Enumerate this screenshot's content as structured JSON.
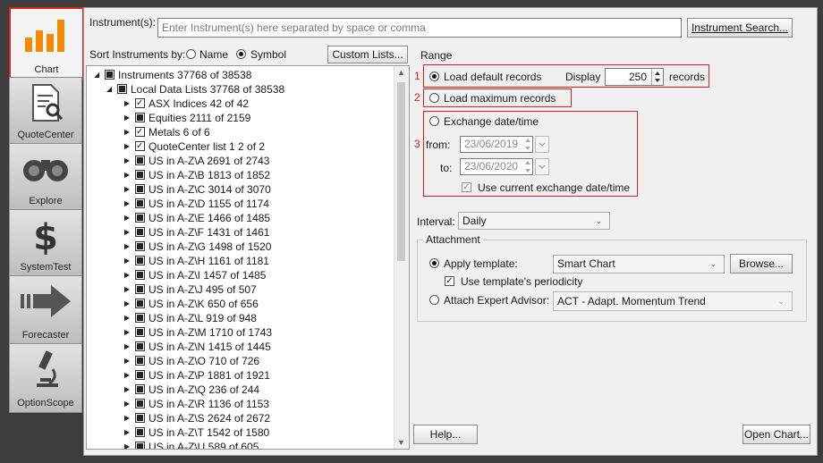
{
  "nav": {
    "items": [
      {
        "label": "Chart",
        "icon": "bar-chart-icon"
      },
      {
        "label": "QuoteCenter",
        "icon": "document-magnifier-icon"
      },
      {
        "label": "Explore",
        "icon": "binoculars-icon"
      },
      {
        "label": "SystemTest",
        "icon": "dollar-icon"
      },
      {
        "label": "Forecaster",
        "icon": "arrow-right-icon"
      },
      {
        "label": "OptionScope",
        "icon": "microscope-icon"
      }
    ]
  },
  "instruments": {
    "label": "Instrument(s):",
    "placeholder": "Enter Instrument(s) here separated by space or comma",
    "search_button": "Instrument Search..."
  },
  "sort": {
    "label": "Sort Instruments by:",
    "name_option": "Name",
    "symbol_option": "Symbol",
    "selected": "Symbol",
    "custom_lists_button": "Custom Lists..."
  },
  "tree": {
    "rows": [
      {
        "text": "Instruments  37768 of 38538",
        "level": 0,
        "expand": "open",
        "check": "partial"
      },
      {
        "text": "Local Data Lists  37768 of 38538",
        "level": 1,
        "expand": "open",
        "check": "partial"
      },
      {
        "text": "ASX Indices  42 of 42",
        "level": 2,
        "expand": "closed",
        "check": "checked"
      },
      {
        "text": "Equities  2111 of 2159",
        "level": 2,
        "expand": "closed",
        "check": "partial"
      },
      {
        "text": "Metals  6 of 6",
        "level": 2,
        "expand": "closed",
        "check": "checked"
      },
      {
        "text": "QuoteCenter list 1  2 of 2",
        "level": 2,
        "expand": "closed",
        "check": "checked"
      },
      {
        "text": "US in A-Z\\A  2691 of 2743",
        "level": 2,
        "expand": "closed",
        "check": "partial"
      },
      {
        "text": "US in A-Z\\B  1813 of 1852",
        "level": 2,
        "expand": "closed",
        "check": "partial"
      },
      {
        "text": "US in A-Z\\C  3014 of 3070",
        "level": 2,
        "expand": "closed",
        "check": "partial"
      },
      {
        "text": "US in A-Z\\D  1155 of 1174",
        "level": 2,
        "expand": "closed",
        "check": "partial"
      },
      {
        "text": "US in A-Z\\E  1466 of 1485",
        "level": 2,
        "expand": "closed",
        "check": "partial"
      },
      {
        "text": "US in A-Z\\F  1431 of 1461",
        "level": 2,
        "expand": "closed",
        "check": "partial"
      },
      {
        "text": "US in A-Z\\G  1498 of 1520",
        "level": 2,
        "expand": "closed",
        "check": "partial"
      },
      {
        "text": "US in A-Z\\H  1161 of 1181",
        "level": 2,
        "expand": "closed",
        "check": "partial"
      },
      {
        "text": "US in A-Z\\I  1457 of 1485",
        "level": 2,
        "expand": "closed",
        "check": "partial"
      },
      {
        "text": "US in A-Z\\J  495 of 507",
        "level": 2,
        "expand": "closed",
        "check": "partial"
      },
      {
        "text": "US in A-Z\\K  650 of 656",
        "level": 2,
        "expand": "closed",
        "check": "partial"
      },
      {
        "text": "US in A-Z\\L  919 of 948",
        "level": 2,
        "expand": "closed",
        "check": "partial"
      },
      {
        "text": "US in A-Z\\M  1710 of 1743",
        "level": 2,
        "expand": "closed",
        "check": "partial"
      },
      {
        "text": "US in A-Z\\N  1415 of 1445",
        "level": 2,
        "expand": "closed",
        "check": "partial"
      },
      {
        "text": "US in A-Z\\O  710 of 726",
        "level": 2,
        "expand": "closed",
        "check": "partial"
      },
      {
        "text": "US in A-Z\\P  1881 of 1921",
        "level": 2,
        "expand": "closed",
        "check": "partial"
      },
      {
        "text": "US in A-Z\\Q  236 of 244",
        "level": 2,
        "expand": "closed",
        "check": "partial"
      },
      {
        "text": "US in A-Z\\R  1136 of 1153",
        "level": 2,
        "expand": "closed",
        "check": "partial"
      },
      {
        "text": "US in A-Z\\S  2624 of 2672",
        "level": 2,
        "expand": "closed",
        "check": "partial"
      },
      {
        "text": "US in A-Z\\T  1542 of 1580",
        "level": 2,
        "expand": "closed",
        "check": "partial"
      },
      {
        "text": "US in A-Z\\U  589 of 605",
        "level": 2,
        "expand": "closed",
        "check": "partial"
      }
    ]
  },
  "range": {
    "title": "Range",
    "marker1": "1",
    "marker2": "2",
    "marker3": "3",
    "load_default": "Load default records",
    "display_label": "Display",
    "display_value": "250",
    "records_label": "records",
    "load_maximum": "Load maximum records",
    "exchange_datetime": "Exchange date/time",
    "from_label": "from:",
    "from_value": "23/06/2019",
    "to_label": "to:",
    "to_value": "23/06/2020",
    "use_current": "Use current exchange date/time"
  },
  "interval": {
    "label": "Interval:",
    "value": "Daily"
  },
  "attachment": {
    "title": "Attachment",
    "apply_template": "Apply template:",
    "template_value": "Smart Chart",
    "browse_button": "Browse...",
    "use_periodicity": "Use template's periodicity",
    "attach_ea": "Attach Expert Advisor:",
    "ea_value": "ACT - Adapt. Momentum Trend"
  },
  "footer": {
    "help_button": "Help...",
    "open_chart_button": "Open Chart..."
  },
  "colors": {
    "accent_red": "#e0201a",
    "chart_orange": "#f08a00"
  }
}
